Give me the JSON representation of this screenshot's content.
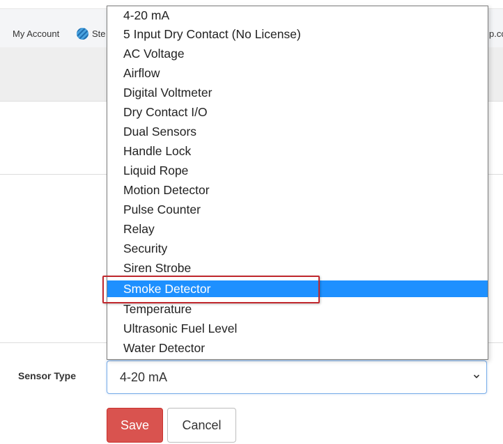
{
  "bookmarks": {
    "account_label": "My Account",
    "steam_label": "Ste",
    "right_label": "p.cc"
  },
  "form": {
    "sensor_type_label": "Sensor Type",
    "selected_value": "4-20 mA",
    "save_label": "Save",
    "cancel_label": "Cancel"
  },
  "dropdown": {
    "highlighted_option": "Smoke Detector",
    "options": [
      "4-20 mA",
      "5 Input Dry Contact (No License)",
      "AC Voltage",
      "Airflow",
      "Digital Voltmeter",
      "Dry Contact I/O",
      "Dual Sensors",
      "Handle Lock",
      "Liquid Rope",
      "Motion Detector",
      "Pulse Counter",
      "Relay",
      "Security",
      "Siren Strobe",
      "Smoke Detector",
      "Temperature",
      "Ultrasonic Fuel Level",
      "Water Detector"
    ]
  },
  "colors": {
    "selected_option_bg": "#1e90ff",
    "save_button_bg": "#d9534f",
    "annotation_box": "#c0272d"
  }
}
